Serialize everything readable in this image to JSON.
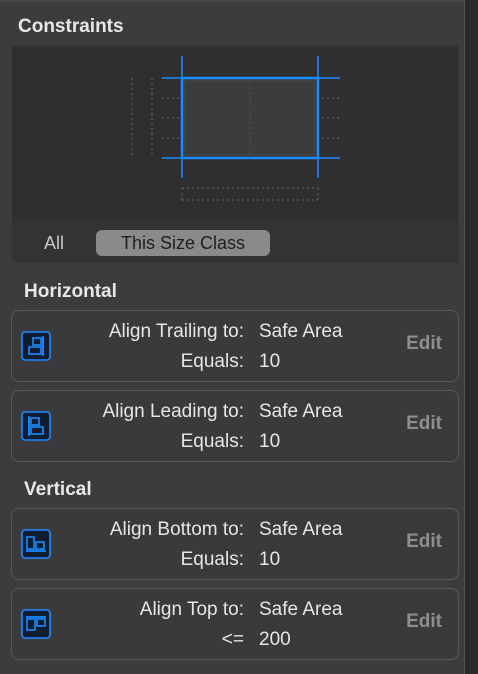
{
  "section_title": "Constraints",
  "segments": {
    "all": "All",
    "size_class": "This Size Class"
  },
  "groups": {
    "horizontal": "Horizontal",
    "vertical": "Vertical"
  },
  "constraints": [
    {
      "line1_label": "Align Trailing to:",
      "line1_value": "Safe Area",
      "line2_label": "Equals:",
      "line2_value": "10",
      "edit": "Edit",
      "icon": "align-trailing-icon"
    },
    {
      "line1_label": "Align Leading to:",
      "line1_value": "Safe Area",
      "line2_label": "Equals:",
      "line2_value": "10",
      "edit": "Edit",
      "icon": "align-leading-icon"
    },
    {
      "line1_label": "Align Bottom to:",
      "line1_value": "Safe Area",
      "line2_label": "Equals:",
      "line2_value": "10",
      "edit": "Edit",
      "icon": "align-bottom-icon"
    },
    {
      "line1_label": "Align Top to:",
      "line1_value": "Safe Area",
      "line2_label": "<=",
      "line2_value": "200",
      "edit": "Edit",
      "icon": "align-top-icon"
    }
  ],
  "colors": {
    "accent": "#1a8cff",
    "background": "#3c3c3e",
    "preview_bg": "#2f2f31"
  }
}
